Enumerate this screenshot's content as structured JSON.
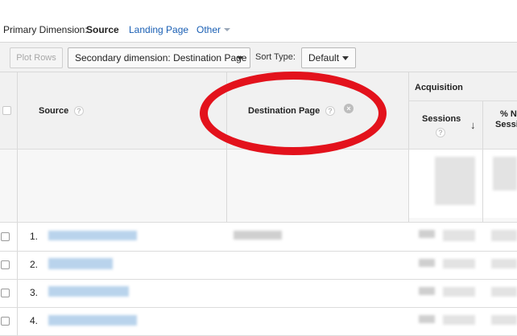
{
  "dimension": {
    "label": "Primary Dimension:",
    "active": "Source",
    "options": [
      "Landing Page",
      "Other"
    ]
  },
  "toolbar": {
    "plot_rows": "Plot Rows",
    "secondary_dimension": "Secondary dimension: Destination Page",
    "sort_type_label": "Sort Type:",
    "sort_type_value": "Default"
  },
  "table": {
    "headers": {
      "source": "Source",
      "destination_page": "Destination Page",
      "acquisition": "Acquisition",
      "sessions": "Sessions",
      "new_sessions_partial": "% N",
      "new_sessions_partial2": "Sessi"
    },
    "help_glyph": "?",
    "close_glyph": "×",
    "rows": [
      {
        "num": "1."
      },
      {
        "num": "2."
      },
      {
        "num": "3."
      },
      {
        "num": "4."
      }
    ]
  },
  "colors": {
    "link": "#1a5fb4",
    "annotation_ring": "#e3121c"
  }
}
